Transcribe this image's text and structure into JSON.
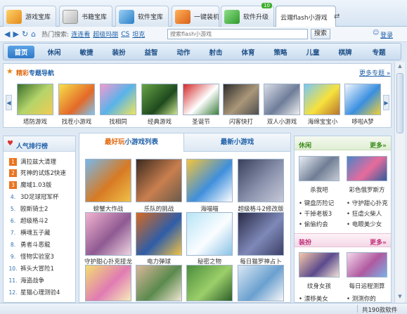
{
  "tabs": [
    {
      "label": "游戏宝库",
      "icon": "game-library-icon"
    },
    {
      "label": "书籍宝库",
      "icon": "book-library-icon"
    },
    {
      "label": "软件宝库",
      "icon": "software-library-icon"
    },
    {
      "label": "一键装机",
      "icon": "one-click-install-icon"
    },
    {
      "label": "软件升级",
      "icon": "software-upgrade-icon",
      "badge": "10"
    },
    {
      "label": "云端flash小游戏",
      "icon": "cloud-flash-icon",
      "active": true
    }
  ],
  "toolbar": {
    "hot_label": "热门搜索:",
    "hot_links": [
      "连连看",
      "超级玛丽",
      "CS",
      "坦克"
    ],
    "search_placeholder": "搜索flash小游戏",
    "search_button": "搜索",
    "login": "登录"
  },
  "nav": [
    "首页",
    "休闲",
    "敏捷",
    "装扮",
    "益智",
    "动作",
    "射击",
    "体育",
    "策略",
    "儿童",
    "棋牌",
    "专题"
  ],
  "featured": {
    "title_accent": "精彩",
    "title_rest": "专题导航",
    "more": "更多专题",
    "items": [
      "塔防游戏",
      "找茬小游戏",
      "找相同",
      "经典游戏",
      "圣诞节",
      "闪客快打",
      "双人小游戏",
      "海绵宝宝小",
      "哆啦A梦"
    ]
  },
  "ranking": {
    "title": "人气排行榜",
    "items": [
      "满拉兹大清理",
      "死神的试炼2快速",
      "魔域1.03版",
      "3D足球冠军杯",
      "殴斯骑士2",
      "超级格斗2",
      "横魂五子藏",
      "勇者斗恶龍",
      "怪物实验室3",
      "裤头大冒险1",
      "海盗战争",
      "星猫心理测验4"
    ]
  },
  "center": {
    "tab1_accent": "最好玩",
    "tab1_rest": "小游戏列表",
    "tab2": "最新小游戏",
    "games": [
      "螃蟹大作战",
      "乐队的挑战",
      "海喵喵",
      "超级格斗2修改版",
      "守护甜心扑克接龙",
      "电力弹球",
      "秘密之物",
      "每日猫罗神占卜",
      "",
      "",
      "",
      ""
    ]
  },
  "leisure": {
    "title": "休闲",
    "more": "更多",
    "games": [
      "杀我吧",
      "彩色俄罗斯方"
    ],
    "links": [
      "键盘历险记",
      "守护甜心扑克",
      "干掉老板3",
      "狂虐火柴人",
      "偷偷约会",
      "电眼美少女"
    ]
  },
  "dressup": {
    "title": "装扮",
    "more": "更多",
    "games": [
      "纹身女孩",
      "每日运程测算"
    ],
    "links": [
      "漂移美女",
      "测测你的"
    ]
  },
  "status": {
    "text": "共190款软件"
  }
}
